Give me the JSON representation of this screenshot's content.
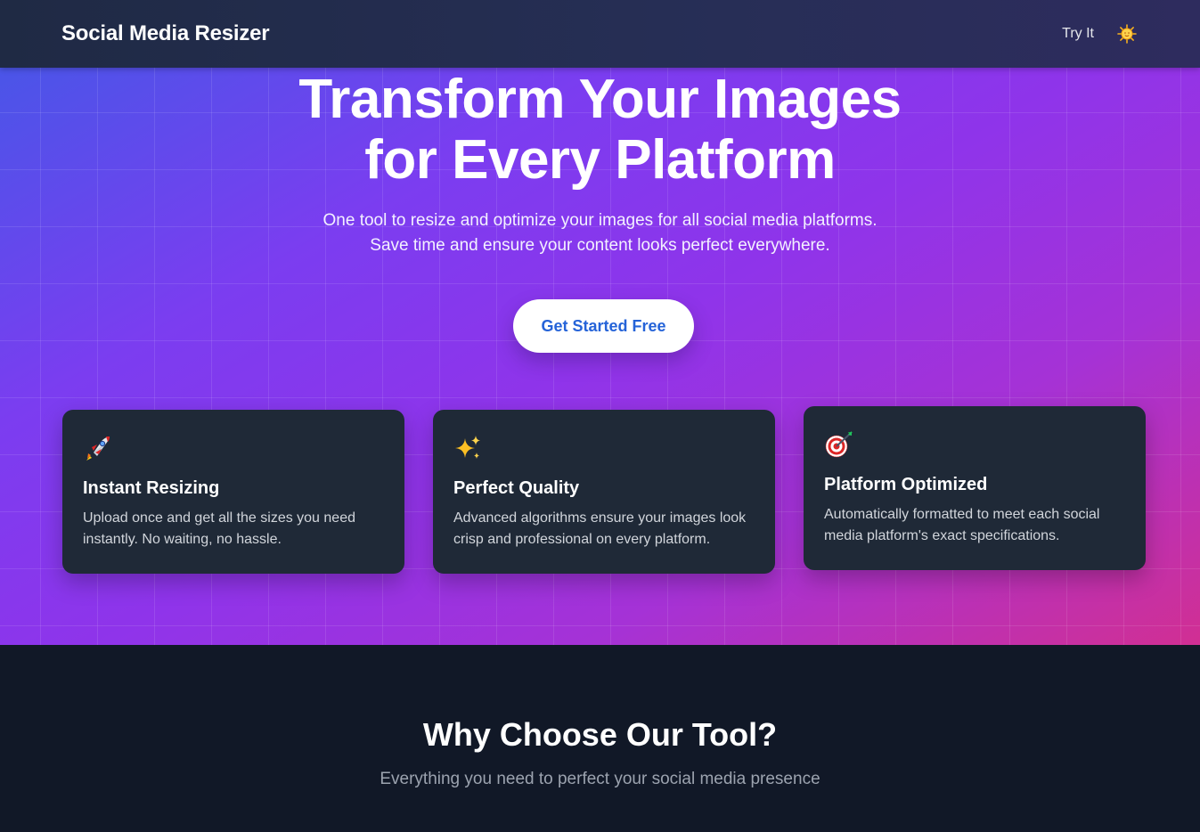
{
  "header": {
    "brand": "Social Media Resizer",
    "nav_link": "Try It",
    "theme_icon": "sun-icon"
  },
  "hero": {
    "title_line1": "Transform Your Images",
    "title_line2": "for Every Platform",
    "subtitle_line1": "One tool to resize and optimize your images for all social media platforms.",
    "subtitle_line2": "Save time and ensure your content looks perfect everywhere.",
    "cta_label": "Get Started Free"
  },
  "features": [
    {
      "icon": "rocket-icon",
      "title": "Instant Resizing",
      "text": "Upload once and get all the sizes you need instantly. No waiting, no hassle."
    },
    {
      "icon": "sparkles-icon",
      "title": "Perfect Quality",
      "text": "Advanced algorithms ensure your images look crisp and professional on every platform."
    },
    {
      "icon": "target-icon",
      "title": "Platform Optimized",
      "text": "Automatically formatted to meet each social media platform's exact specifications."
    }
  ],
  "why": {
    "title": "Why Choose Our Tool?",
    "subtitle": "Everything you need to perfect your social media presence"
  },
  "colors": {
    "cta_text": "#2563d8",
    "card_bg": "#1f2937",
    "section_bg": "#111827"
  }
}
